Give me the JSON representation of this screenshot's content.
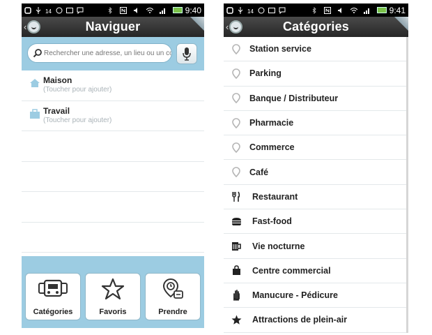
{
  "left": {
    "status": {
      "time": "9:40"
    },
    "title": "Naviguer",
    "search": {
      "placeholder": "Rechercher une adresse, un lieu ou un con",
      "value": ""
    },
    "favorites": [
      {
        "name": "Maison",
        "hint": "(Toucher pour ajouter)",
        "icon": "home-icon"
      },
      {
        "name": "Travail",
        "hint": "(Toucher pour ajouter)",
        "icon": "briefcase-icon"
      }
    ],
    "actions": [
      {
        "label": "Catégories",
        "icon": "categories-icon"
      },
      {
        "label": "Favoris",
        "icon": "star-outline-icon"
      },
      {
        "label": "Prendre",
        "icon": "clock-pin-icon"
      }
    ]
  },
  "right": {
    "status": {
      "time": "9:41"
    },
    "title": "Catégories",
    "categories": [
      {
        "label": "Station service",
        "icon": "pin-icon"
      },
      {
        "label": "Parking",
        "icon": "pin-icon"
      },
      {
        "label": "Banque / Distributeur",
        "icon": "pin-icon"
      },
      {
        "label": "Pharmacie",
        "icon": "pin-icon"
      },
      {
        "label": "Commerce",
        "icon": "pin-icon"
      },
      {
        "label": "Café",
        "icon": "pin-icon"
      },
      {
        "label": "Restaurant",
        "icon": "fork-knife-icon"
      },
      {
        "label": "Fast-food",
        "icon": "burger-icon"
      },
      {
        "label": "Vie nocturne",
        "icon": "beer-mug-icon"
      },
      {
        "label": "Centre commercial",
        "icon": "shopping-bag-icon"
      },
      {
        "label": "Manucure - Pédicure",
        "icon": "hand-icon"
      },
      {
        "label": "Attractions de plein-air",
        "icon": "star-icon"
      }
    ]
  },
  "colors": {
    "accent_band": "#9ccce2",
    "titlebar": "#333333",
    "battery": "#7cc24a"
  }
}
